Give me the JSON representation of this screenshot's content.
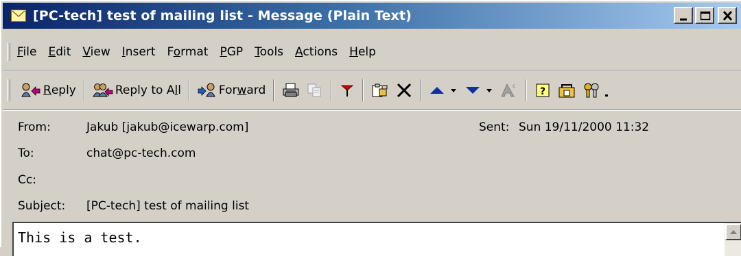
{
  "window": {
    "title": "[PC-tech] test of mailing list - Message (Plain Text)"
  },
  "menu": {
    "items": [
      {
        "pre": "",
        "ul": "F",
        "post": "ile"
      },
      {
        "pre": "",
        "ul": "E",
        "post": "dit"
      },
      {
        "pre": "",
        "ul": "V",
        "post": "iew"
      },
      {
        "pre": "",
        "ul": "I",
        "post": "nsert"
      },
      {
        "pre": "F",
        "ul": "o",
        "post": "rmat"
      },
      {
        "pre": "",
        "ul": "P",
        "post": "GP"
      },
      {
        "pre": "",
        "ul": "T",
        "post": "ools"
      },
      {
        "pre": "",
        "ul": "A",
        "post": "ctions"
      },
      {
        "pre": "",
        "ul": "H",
        "post": "elp"
      }
    ]
  },
  "toolbar": {
    "reply": {
      "pre": "",
      "ul": "R",
      "post": "eply"
    },
    "reply_all": {
      "pre": "Reply to A",
      "ul": "l",
      "post": "l"
    },
    "forward": {
      "pre": "For",
      "ul": "w",
      "post": "ard"
    },
    "icons": [
      "reply-icon",
      "reply-all-icon",
      "forward-icon",
      "print-icon",
      "copy-icon",
      "flag-icon",
      "move-to-folder-icon",
      "delete-icon",
      "previous-item-icon",
      "next-item-icon",
      "address-book-icon",
      "help-icon",
      "pgp-encrypt-icon",
      "pgp-keys-icon"
    ]
  },
  "header": {
    "from_label": "From:",
    "from_value": "Jakub [jakub@icewarp.com]",
    "sent_label": "Sent:",
    "sent_value": "Sun 19/11/2000 11:32",
    "to_label": "To:",
    "to_value": "chat@pc-tech.com",
    "cc_label": "Cc:",
    "cc_value": "",
    "subject_label": "Subject:",
    "subject_value": "[PC-tech] test of mailing list"
  },
  "body": {
    "text": "This is a test."
  },
  "colors": {
    "titlebar_start": "#0a246a",
    "titlebar_end": "#a6caf0",
    "face": "#d4d0c8"
  }
}
